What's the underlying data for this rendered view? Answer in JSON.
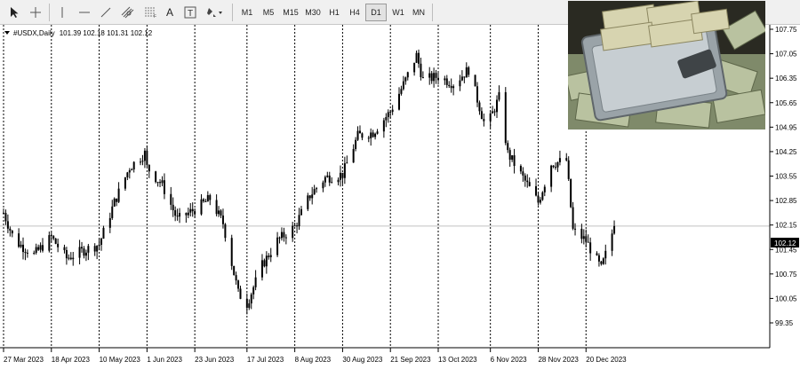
{
  "toolbar": {
    "tools": [
      {
        "name": "cursor-icon"
      },
      {
        "name": "crosshair-icon"
      },
      {
        "name": "vertical-line-icon"
      },
      {
        "name": "horizontal-line-icon"
      },
      {
        "name": "trend-line-icon"
      },
      {
        "name": "channel-icon"
      },
      {
        "name": "fibonacci-icon"
      },
      {
        "name": "text-icon",
        "label": "A"
      },
      {
        "name": "text-label-icon",
        "label": "T"
      },
      {
        "name": "shapes-icon"
      }
    ],
    "timeframes": [
      "M1",
      "M5",
      "M15",
      "M30",
      "H1",
      "H4",
      "D1",
      "W1",
      "MN"
    ],
    "active_timeframe": "D1"
  },
  "chart_header": {
    "symbol": "#USDX,Daily",
    "ohlc": "101.39 102.18 101.31 102.12"
  },
  "current_price": "102.12",
  "colors": {
    "candle": "#000000",
    "grid": "#000000",
    "price_label_bg": "#000000",
    "price_label_text": "#ffffff",
    "current_price_line": "#c0c0c0"
  },
  "chart_data": {
    "type": "candlestick",
    "symbol": "#USDX",
    "timeframe": "Daily",
    "x_tick_labels": [
      "27 Mar 2023",
      "18 Apr 2023",
      "10 May 2023",
      "1 Jun 2023",
      "23 Jun 2023",
      "17 Jul 2023",
      "8 Aug 2023",
      "30 Aug 2023",
      "21 Sep 2023",
      "13 Oct 2023",
      "6 Nov 2023",
      "28 Nov 2023",
      "20 Dec 2023"
    ],
    "y_tick_labels": [
      "107.75",
      "107.05",
      "106.35",
      "105.65",
      "104.95",
      "104.25",
      "103.55",
      "102.85",
      "102.15",
      "101.45",
      "100.75",
      "100.05",
      "99.35"
    ],
    "ylim": [
      99.35,
      107.75
    ],
    "grid": "vertical dotted",
    "approx_close_path": [
      [
        "27 Mar 2023",
        102.5
      ],
      [
        "1 Apr 2023",
        101.7
      ],
      [
        "10 Apr 2023",
        101.3
      ],
      [
        "18 Apr 2023",
        101.8
      ],
      [
        "25 Apr 2023",
        101.2
      ],
      [
        "2 May 2023",
        101.4
      ],
      [
        "10 May 2023",
        101.6
      ],
      [
        "17 May 2023",
        102.8
      ],
      [
        "24 May 2023",
        103.8
      ],
      [
        "31 May 2023",
        104.2
      ],
      [
        "1 Jun 2023",
        103.8
      ],
      [
        "8 Jun 2023",
        103.3
      ],
      [
        "15 Jun 2023",
        102.3
      ],
      [
        "23 Jun 2023",
        102.6
      ],
      [
        "30 Jun 2023",
        102.9
      ],
      [
        "6 Jul 2023",
        102.2
      ],
      [
        "13 Jul 2023",
        100.2
      ],
      [
        "17 Jul 2023",
        99.9
      ],
      [
        "24 Jul 2023",
        101.0
      ],
      [
        "31 Jul 2023",
        101.7
      ],
      [
        "8 Aug 2023",
        102.1
      ],
      [
        "15 Aug 2023",
        103.0
      ],
      [
        "22 Aug 2023",
        103.5
      ],
      [
        "30 Aug 2023",
        103.6
      ],
      [
        "6 Sep 2023",
        104.7
      ],
      [
        "13 Sep 2023",
        104.8
      ],
      [
        "21 Sep 2023",
        105.4
      ],
      [
        "28 Sep 2023",
        106.3
      ],
      [
        "3 Oct 2023",
        107.0
      ],
      [
        "6 Oct 2023",
        106.3
      ],
      [
        "13 Oct 2023",
        106.4
      ],
      [
        "20 Oct 2023",
        106.2
      ],
      [
        "27 Oct 2023",
        106.6
      ],
      [
        "3 Nov 2023",
        105.1
      ],
      [
        "6 Nov 2023",
        105.2
      ],
      [
        "10 Nov 2023",
        105.8
      ],
      [
        "14 Nov 2023",
        104.2
      ],
      [
        "21 Nov 2023",
        103.5
      ],
      [
        "28 Nov 2023",
        102.8
      ],
      [
        "4 Dec 2023",
        103.9
      ],
      [
        "11 Dec 2023",
        104.0
      ],
      [
        "14 Dec 2023",
        102.0
      ],
      [
        "20 Dec 2023",
        101.7
      ],
      [
        "27 Dec 2023",
        100.9
      ],
      [
        "29 Dec 2023",
        101.3
      ],
      [
        "2 Jan 2024",
        102.12
      ]
    ]
  }
}
